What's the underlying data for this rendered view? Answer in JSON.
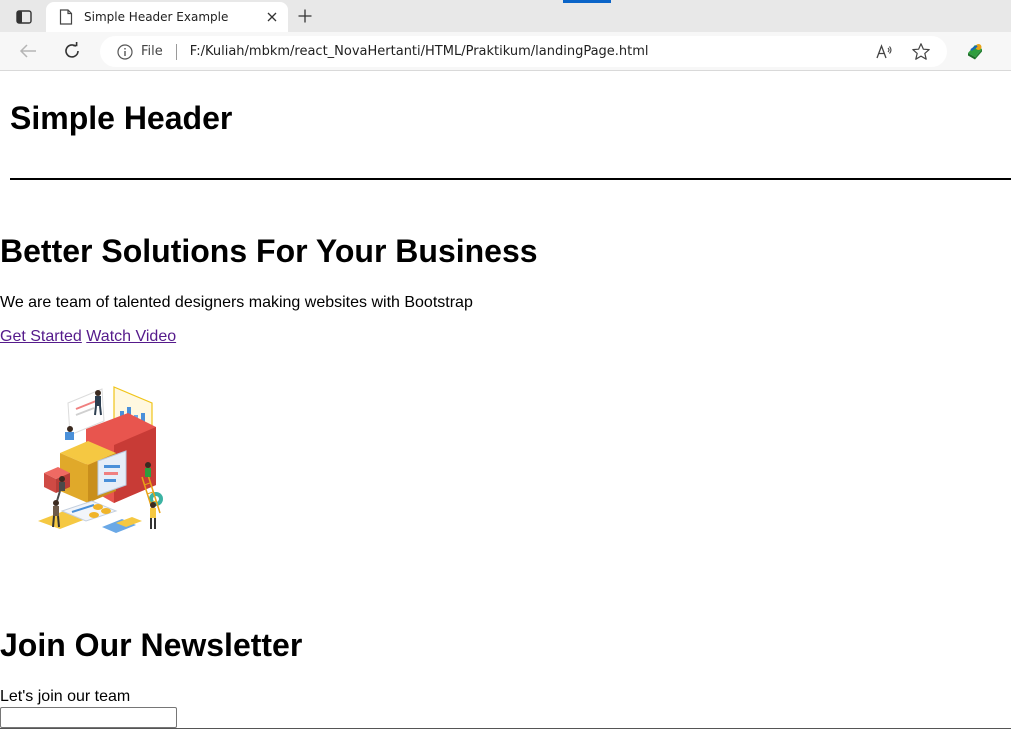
{
  "browser": {
    "tab_title": "Simple Header Example",
    "address": {
      "label": "File",
      "url": "F:/Kuliah/mbkm/react_NovaHertanti/HTML/Praktikum/landingPage.html"
    },
    "icons": {
      "tab_actions": "tab-actions-icon",
      "page": "page-icon",
      "close": "close-icon",
      "new_tab": "plus-icon",
      "back": "back-arrow-icon",
      "refresh": "refresh-icon",
      "info": "info-icon",
      "read_aloud": "read-aloud-icon",
      "favorite": "star-icon",
      "extension": "extension-icon"
    },
    "accent_color": "#0a64c8"
  },
  "page": {
    "header": {
      "title": "Simple Header"
    },
    "hero": {
      "title": "Better Solutions For Your Business",
      "text": "We are team of talented designers making websites with Bootstrap",
      "links": [
        {
          "label": "Get Started"
        },
        {
          "label": "Watch Video"
        }
      ],
      "image": "business-illustration"
    },
    "newsletter": {
      "title": "Join Our Newsletter",
      "text": "Let's join our team",
      "input_value": ""
    },
    "link_color": "#551a8b"
  }
}
